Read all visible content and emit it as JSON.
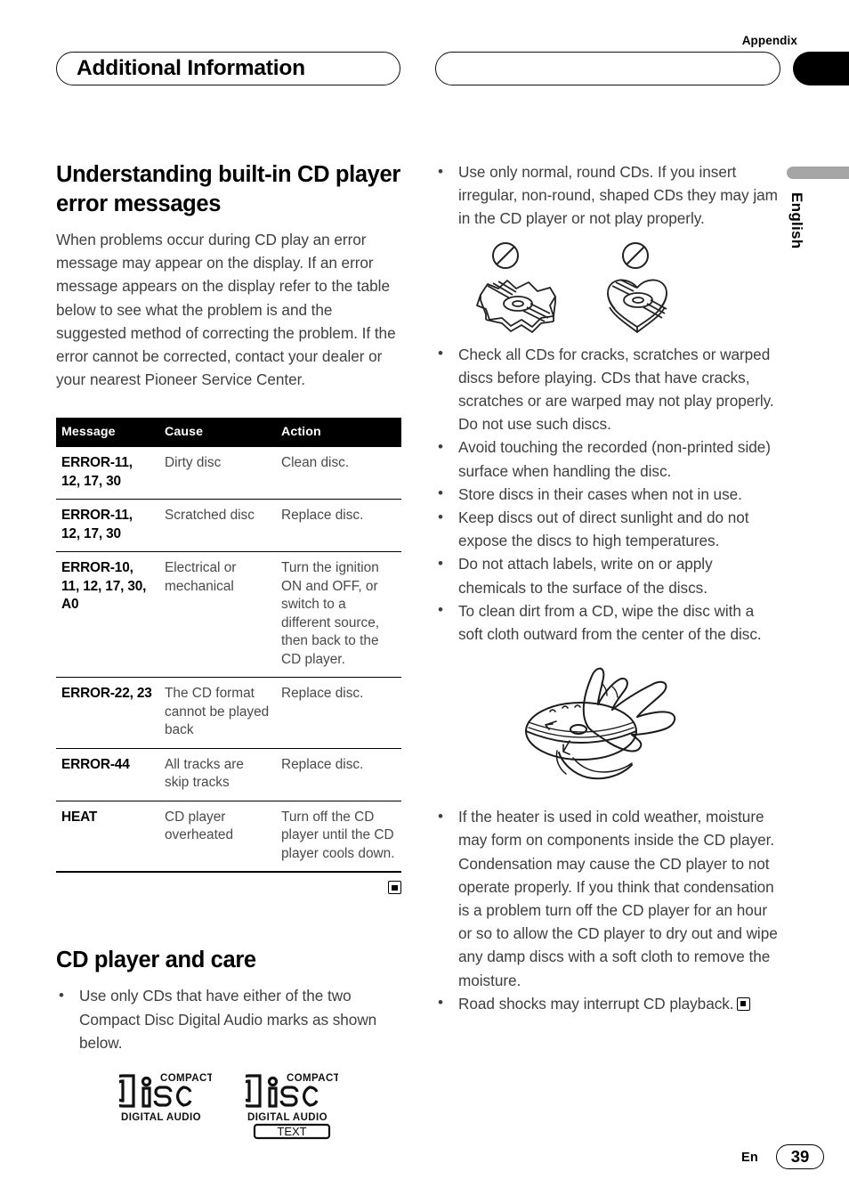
{
  "header": {
    "appendix_label": "Appendix",
    "section_title": "Additional Information"
  },
  "margin": {
    "language": "English"
  },
  "left_column": {
    "heading": "Understanding built-in CD player error messages",
    "intro": "When problems occur during CD play an error message may appear on the display. If an error message appears on the display refer to the table below to see what the problem is and the suggested method of correcting the problem. If the error cannot be corrected, contact your dealer or your nearest Pioneer Service Center.",
    "table": {
      "headers": [
        "Message",
        "Cause",
        "Action"
      ],
      "rows": [
        {
          "message": "ERROR-11, 12, 17, 30",
          "cause": "Dirty disc",
          "action": "Clean disc."
        },
        {
          "message": "ERROR-11, 12, 17, 30",
          "cause": "Scratched disc",
          "action": "Replace disc."
        },
        {
          "message": "ERROR-10, 11, 12, 17, 30, A0",
          "cause": "Electrical or mechanical",
          "action": "Turn the ignition ON and OFF, or switch to a different source, then back to the CD player."
        },
        {
          "message": "ERROR-22, 23",
          "cause": "The CD format cannot be played back",
          "action": "Replace disc."
        },
        {
          "message": "ERROR-44",
          "cause": "All tracks are skip tracks",
          "action": "Replace disc."
        },
        {
          "message": "HEAT",
          "cause": "CD player overheated",
          "action": "Turn off the CD player until the CD player cools down."
        }
      ]
    },
    "care_heading": "CD player and care",
    "care_bullets": [
      "Use only CDs that have either of the two Compact Disc Digital Audio marks as shown below."
    ],
    "logos": [
      {
        "top": "COMPACT",
        "mid": "disc",
        "bottom": "DIGITAL AUDIO",
        "extra": ""
      },
      {
        "top": "COMPACT",
        "mid": "disc",
        "bottom": "DIGITAL AUDIO",
        "extra": "TEXT"
      }
    ]
  },
  "right_column": {
    "bullets_top": [
      "Use only normal, round CDs. If you insert irregular, non-round, shaped CDs they may jam in the CD player or not play properly."
    ],
    "bullets_mid": [
      "Check all CDs for cracks, scratches or warped discs before playing. CDs that have cracks, scratches or are warped may not play properly. Do not use such discs.",
      "Avoid touching the recorded (non-printed side) surface when handling the disc.",
      "Store discs in their cases when not in use.",
      "Keep discs out of direct sunlight and do not expose the discs to high temperatures.",
      "Do not attach labels, write on or apply chemicals to the surface of the discs.",
      "To clean dirt from a CD, wipe the disc with a soft cloth outward from the center of the disc."
    ],
    "bullets_bottom": [
      "If the heater is used in cold weather, moisture may form on components inside the CD player. Condensation may cause the CD player to not operate properly. If you think that condensation is a problem turn off the CD player for an hour or so to allow the CD player to dry out and wipe any damp discs with a soft cloth to remove the moisture.",
      "Road shocks may interrupt CD playback."
    ]
  },
  "footer": {
    "language_code": "En",
    "page_number": "39"
  },
  "colors": {
    "ink": "#000000",
    "body_text": "#3f3f3f",
    "table_header_bg": "#000000",
    "margin_bar": "#a5a5a5"
  }
}
